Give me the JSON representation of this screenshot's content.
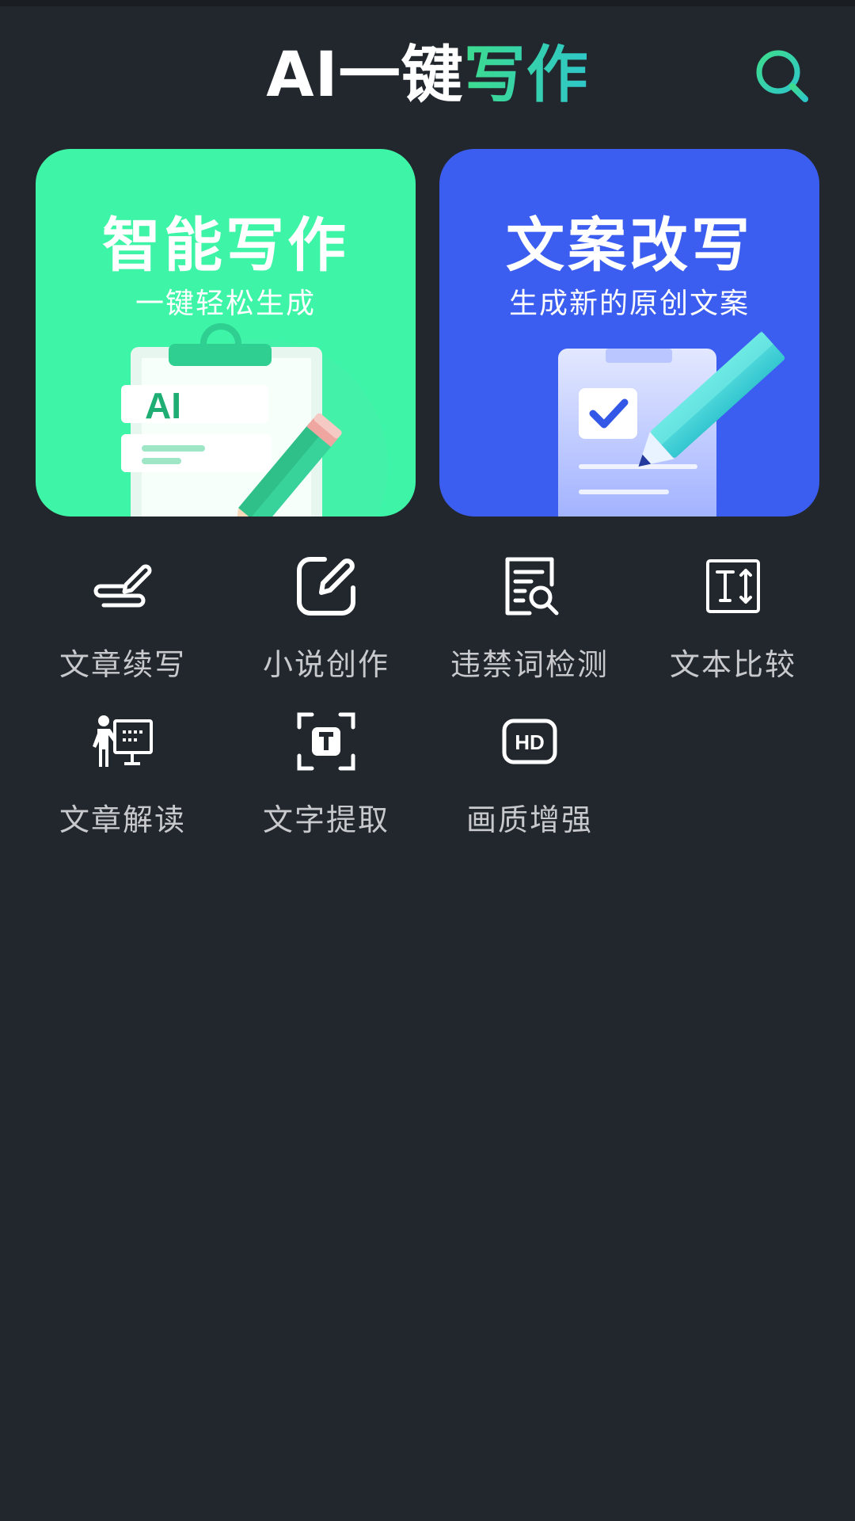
{
  "header": {
    "title_part1": "AI一键",
    "title_part2": "写作",
    "search_icon": "search-icon"
  },
  "cards": [
    {
      "title": "智能写作",
      "subtitle": "一键轻松生成",
      "illustration_text": "AI",
      "color": "#3ef4a6"
    },
    {
      "title": "文案改写",
      "subtitle": "生成新的原创文案",
      "color": "#3b5df0"
    }
  ],
  "tools": [
    {
      "label": "文章续写",
      "icon": "pen-scribble-icon"
    },
    {
      "label": "小说创作",
      "icon": "edit-square-icon"
    },
    {
      "label": "违禁词检测",
      "icon": "document-search-icon"
    },
    {
      "label": "文本比较",
      "icon": "text-compare-icon"
    },
    {
      "label": "文章解读",
      "icon": "teacher-board-icon"
    },
    {
      "label": "文字提取",
      "icon": "text-scan-icon"
    },
    {
      "label": "画质增强",
      "icon": "hd-icon"
    }
  ],
  "colors": {
    "background": "#22272d",
    "accent_green": "#3ddc8e",
    "accent_teal": "#2fc6c8",
    "card_green": "#3ef4a6",
    "card_blue": "#3b5df0",
    "label_gray": "#c7c9cc"
  }
}
